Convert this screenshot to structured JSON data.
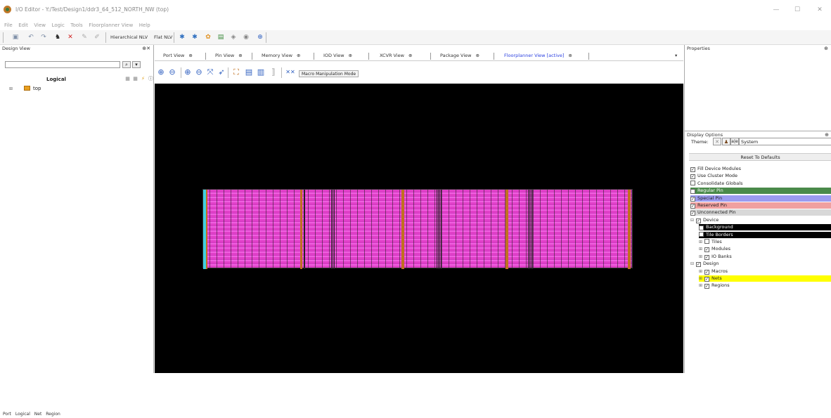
{
  "window": {
    "title": "I/O Editor - Y:/Test/Design1/ddr3_64_512_NORTH_NW (top)",
    "minimize": "—",
    "maximize": "☐",
    "close": "✕"
  },
  "menu": [
    "File",
    "Edit",
    "View",
    "Logic",
    "Tools",
    "Floorplanner View",
    "Help"
  ],
  "toolbar": {
    "hierarchical_nlv": "Hierarchical NLV",
    "flat_nlv": "Flat NLV"
  },
  "design_view": {
    "title": "Design View",
    "header": "Logical",
    "tree_root": "top",
    "bottom_tabs": [
      "Port",
      "Logical",
      "Net",
      "Region"
    ]
  },
  "view_tabs": [
    {
      "label": "Port View",
      "active": false
    },
    {
      "label": "Pin View",
      "active": false
    },
    {
      "label": "Memory View",
      "active": false
    },
    {
      "label": "IOD View",
      "active": false
    },
    {
      "label": "XCVR View",
      "active": false
    },
    {
      "label": "Package View",
      "active": false
    },
    {
      "label": "Floorplanner View [active]",
      "active": true
    }
  ],
  "floorplanner": {
    "macro_mode_label": "Macro Manipulation Mode",
    "background_color": "#000000"
  },
  "properties": {
    "title": "Properties"
  },
  "display_options": {
    "title": "Display Options",
    "theme_label": "Theme:",
    "theme_value": "System",
    "reset_label": "Reset To Defaults",
    "options": [
      {
        "label": "Fill Device Modules",
        "checked": true,
        "highlight": "",
        "indent": 0
      },
      {
        "label": "Use Cluster Mode",
        "checked": true,
        "highlight": "",
        "indent": 0
      },
      {
        "label": "Consolidate Globals",
        "checked": false,
        "highlight": "",
        "indent": 0
      },
      {
        "label": "Regular Pin",
        "checked": true,
        "highlight": "#4a8a4a",
        "indent": 0
      },
      {
        "label": "Special Pin",
        "checked": true,
        "highlight": "#9b9bf0",
        "indent": 0
      },
      {
        "label": "Reserved Pin",
        "checked": true,
        "highlight": "#f0a0a0",
        "indent": 0
      },
      {
        "label": "Unconnected Pin",
        "checked": true,
        "highlight": "#d8d8d8",
        "indent": 0
      },
      {
        "label": "Device",
        "checked": true,
        "highlight": "",
        "indent": 0,
        "expander": "⊟"
      },
      {
        "label": "Background",
        "checked": true,
        "highlight": "#000000",
        "indent": 1
      },
      {
        "label": "Tile Borders",
        "checked": false,
        "highlight": "#000000",
        "indent": 1
      },
      {
        "label": "Tiles",
        "checked": false,
        "highlight": "",
        "indent": 1,
        "expander": "⊞"
      },
      {
        "label": "Modules",
        "checked": true,
        "highlight": "",
        "indent": 1,
        "expander": "⊞"
      },
      {
        "label": "IO Banks",
        "checked": true,
        "highlight": "",
        "indent": 1,
        "expander": "⊞"
      },
      {
        "label": "Design",
        "checked": true,
        "highlight": "",
        "indent": 0,
        "expander": "⊟"
      },
      {
        "label": "Macros",
        "checked": true,
        "highlight": "",
        "indent": 1,
        "expander": "⊞"
      },
      {
        "label": "Nets",
        "checked": true,
        "highlight": "#ffff00",
        "indent": 1,
        "expander": "⊞"
      },
      {
        "label": "Regions",
        "checked": true,
        "highlight": "",
        "indent": 1,
        "expander": "⊞"
      }
    ]
  }
}
